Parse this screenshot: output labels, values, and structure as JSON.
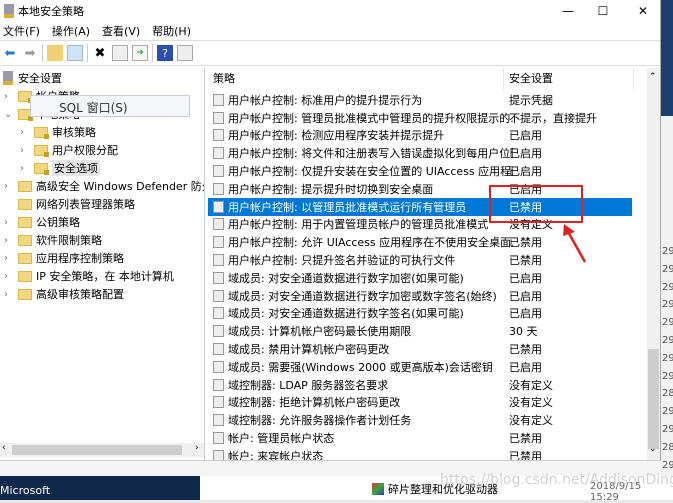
{
  "window": {
    "title": "本地安全策略",
    "minimize": "—",
    "maximize": "☐",
    "close": "✕"
  },
  "menu": [
    "文件(F)",
    "操作(A)",
    "查看(V)",
    "帮助(H)"
  ],
  "toolbar": [
    "back-icon",
    "forward-icon",
    "up-folder-icon",
    "show-hide-tree-icon",
    "delete-icon",
    "properties-icon",
    "export-icon",
    "help-icon",
    "console-icon"
  ],
  "tree": {
    "root": "安全设置",
    "items": [
      {
        "label": "帐户策略",
        "level": 1,
        "chevron": "›"
      },
      {
        "label": "本地策略",
        "level": 1,
        "chevron": "⌄"
      },
      {
        "label": "审核策略",
        "level": 2,
        "chevron": "›"
      },
      {
        "label": "用户权限分配",
        "level": 2,
        "chevron": "›"
      },
      {
        "label": "安全选项",
        "level": 2,
        "chevron": "›"
      },
      {
        "label": "高级安全 Windows Defender 防火墙",
        "level": 1,
        "chevron": "›"
      },
      {
        "label": "网络列表管理器策略",
        "level": 1,
        "chevron": ""
      },
      {
        "label": "公钥策略",
        "level": 1,
        "chevron": "›"
      },
      {
        "label": "软件限制策略",
        "level": 1,
        "chevron": "›"
      },
      {
        "label": "应用程序控制策略",
        "level": 1,
        "chevron": "›"
      },
      {
        "label": "IP 安全策略，在 本地计算机",
        "level": 1,
        "chevron": "›"
      },
      {
        "label": "高级审核策略配置",
        "level": 1,
        "chevron": "›"
      }
    ],
    "tooltip": "SQL 窗口(S)"
  },
  "list": {
    "columns": [
      "策略",
      "安全设置"
    ],
    "rows": [
      {
        "policy": "用户帐户控制: 标准用户的提升提示行为",
        "setting": "提示凭据"
      },
      {
        "policy": "用户帐户控制: 管理员批准模式中管理员的提升权限提示的...",
        "setting": "不提示，直接提升"
      },
      {
        "policy": "用户帐户控制: 检测应用程序安装并提示提升",
        "setting": "已启用"
      },
      {
        "policy": "用户帐户控制: 将文件和注册表写入错误虚拟化到每用户位置",
        "setting": "已启用"
      },
      {
        "policy": "用户帐户控制: 仅提升安装在安全位置的 UIAccess 应用程序",
        "setting": "已启用"
      },
      {
        "policy": "用户帐户控制: 提示提升时切换到安全桌面",
        "setting": "已启用"
      },
      {
        "policy": "用户帐户控制: 以管理员批准模式运行所有管理员",
        "setting": "已禁用",
        "selected": true
      },
      {
        "policy": "用户帐户控制: 用于内置管理员帐户的管理员批准模式",
        "setting": "没有定义"
      },
      {
        "policy": "用户帐户控制: 允许 UIAccess 应用程序在不使用安全桌面...",
        "setting": "已禁用"
      },
      {
        "policy": "用户帐户控制: 只提升签名并验证的可执行文件",
        "setting": "已禁用"
      },
      {
        "policy": "域成员: 对安全通道数据进行数字加密(如果可能)",
        "setting": "已启用"
      },
      {
        "policy": "域成员: 对安全通道数据进行数字加密或数字签名(始终)",
        "setting": "已启用"
      },
      {
        "policy": "域成员: 对安全通道数据进行数字签名(如果可能)",
        "setting": "已启用"
      },
      {
        "policy": "域成员: 计算机帐户密码最长使用期限",
        "setting": "30 天"
      },
      {
        "policy": "域成员: 禁用计算机帐户密码更改",
        "setting": "已禁用"
      },
      {
        "policy": "域成员: 需要强(Windows 2000 或更高版本)会话密钥",
        "setting": "已启用"
      },
      {
        "policy": "域控制器: LDAP 服务器签名要求",
        "setting": "没有定义"
      },
      {
        "policy": "域控制器: 拒绝计算机帐户密码更改",
        "setting": "没有定义"
      },
      {
        "policy": "域控制器: 允许服务器操作者计划任务",
        "setting": "没有定义"
      },
      {
        "policy": "帐户: 管理员帐户状态",
        "setting": "已禁用"
      },
      {
        "policy": "帐户: 来宾帐户状态",
        "setting": "已禁用"
      }
    ]
  },
  "annotation": {
    "color": "#e32020"
  },
  "desktop": {
    "numbers": [
      "29",
      "29",
      "29",
      "29",
      "29",
      "29",
      "29",
      "29",
      "28",
      "29",
      "29",
      "28",
      "29"
    ],
    "taskbar_label": "Microsoft",
    "file_name": "碎片整理和优化驱动器",
    "file_date": "2018/9/15 15:29",
    "watermark": "https://blog.csdn.net/AddisonDing"
  },
  "colors": {
    "selection": "#0078d7"
  }
}
